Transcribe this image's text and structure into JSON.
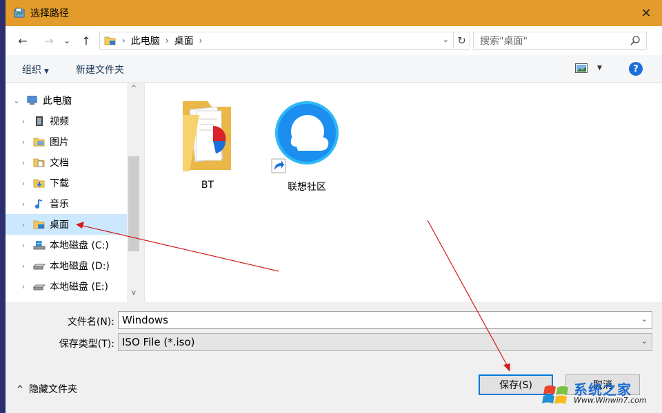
{
  "window": {
    "title": "选择路径",
    "close_symbol": "✕"
  },
  "address": {
    "back_symbol": "←",
    "forward_symbol": "→",
    "recent_symbol": "⌄",
    "up_symbol": "↑",
    "separator": "›",
    "crumbs": [
      "此电脑",
      "桌面"
    ],
    "dropdown_symbol": "⌄",
    "refresh_symbol": "↻"
  },
  "search": {
    "placeholder": "搜索\"桌面\""
  },
  "toolbar": {
    "organize_label": "组织",
    "organize_caret": "▼",
    "new_folder_label": "新建文件夹",
    "view_caret": "▼",
    "help_label": "?"
  },
  "nav": {
    "items": [
      {
        "label": "此电脑",
        "chevron": "⌄",
        "icon": "computer-icon"
      },
      {
        "label": "视频",
        "chevron": "›",
        "icon": "videos-folder-icon"
      },
      {
        "label": "图片",
        "chevron": "›",
        "icon": "pictures-folder-icon"
      },
      {
        "label": "文档",
        "chevron": "›",
        "icon": "documents-folder-icon"
      },
      {
        "label": "下载",
        "chevron": "›",
        "icon": "downloads-folder-icon"
      },
      {
        "label": "音乐",
        "chevron": "›",
        "icon": "music-folder-icon"
      },
      {
        "label": "桌面",
        "chevron": "›",
        "icon": "desktop-folder-icon",
        "selected": true
      },
      {
        "label": "本地磁盘 (C:)",
        "chevron": "›",
        "icon": "windows-drive-icon"
      },
      {
        "label": "本地磁盘 (D:)",
        "chevron": "›",
        "icon": "drive-icon"
      },
      {
        "label": "本地磁盘 (E:)",
        "chevron": "›",
        "icon": "drive-icon"
      }
    ],
    "scroll_up": "^",
    "scroll_down": "v"
  },
  "files": [
    {
      "label": "BT",
      "icon": "folder-icon"
    },
    {
      "label": "联想社区",
      "icon": "qq-browser-shortcut-icon"
    }
  ],
  "form": {
    "filename_label": "文件名(N):",
    "filename_value": "Windows",
    "filetype_label": "保存类型(T):",
    "filetype_value": "ISO File (*.iso)",
    "drop_symbol": "⌄"
  },
  "footer": {
    "hide_folders_caret": "^",
    "hide_folders_label": "隐藏文件夹",
    "save_label": "保存(S)",
    "cancel_label": "取消"
  },
  "watermark": {
    "text": "系统之家",
    "url": "Www.Winwin7.com"
  },
  "colors": {
    "titlebar": "#e39c2b",
    "annotation_arrow": "#d11a1a",
    "selection": "#cce8ff",
    "accent": "#0078d7"
  }
}
